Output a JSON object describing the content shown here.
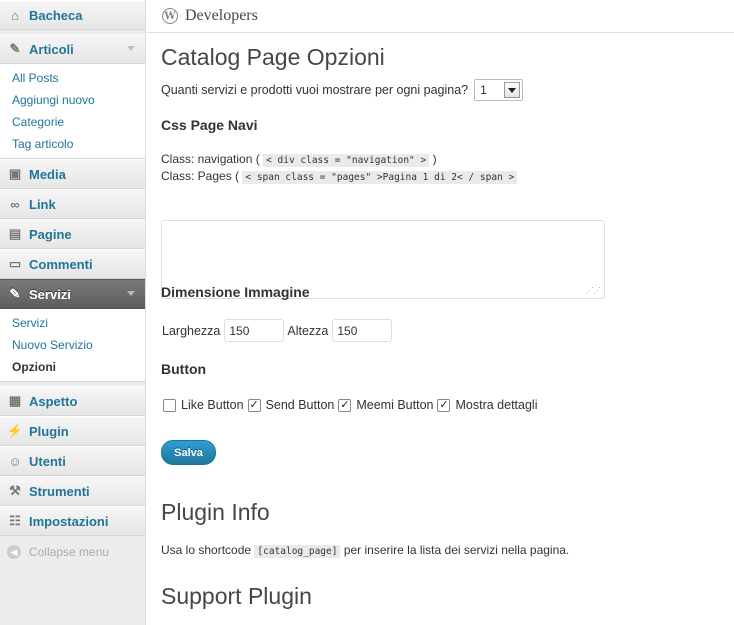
{
  "sidebar": {
    "bacheca": "Bacheca",
    "articoli": "Articoli",
    "articoli_items": [
      "All Posts",
      "Aggiungi nuovo",
      "Categorie",
      "Tag articolo"
    ],
    "media": "Media",
    "link": "Link",
    "pagine": "Pagine",
    "commenti": "Commenti",
    "servizi": "Servizi",
    "servizi_items": [
      "Servizi",
      "Nuovo Servizio",
      "Opzioni"
    ],
    "aspetto": "Aspetto",
    "plugin": "Plugin",
    "utenti": "Utenti",
    "strumenti": "Strumenti",
    "impostazioni": "Impostazioni",
    "collapse": "Collapse menu"
  },
  "header": {
    "site_name": "Developers"
  },
  "page": {
    "title": "Catalog Page Opzioni",
    "per_page_label": "Quanti servizi e prodotti vuoi mostrare per ogni pagina?",
    "per_page_value": "1",
    "css_title": "Css Page Navi",
    "class_nav_prefix": "Class: navigation (",
    "class_nav_code": "< div class = \"navigation\" >",
    "class_nav_suffix": ")",
    "class_pages_prefix": "Class: Pages (",
    "class_pages_code": "< span class = \"pages\" >Pagina 1 di 2< / span >",
    "css_textarea_value": "",
    "dim_title": "Dimensione Immagine",
    "larghezza_label": "Larghezza",
    "larghezza_value": "150",
    "altezza_label": "Altezza",
    "altezza_value": "150",
    "button_title": "Button",
    "buttons": [
      {
        "label": "Like Button",
        "checked": false
      },
      {
        "label": "Send Button",
        "checked": true
      },
      {
        "label": "Meemi Button",
        "checked": true
      },
      {
        "label": "Mostra dettagli",
        "checked": true
      }
    ],
    "save_label": "Salva",
    "plugin_info_title": "Plugin Info",
    "shortcode_prefix": "Usa lo shortcode",
    "shortcode_code": "[catalog_page]",
    "shortcode_suffix": "per inserire la lista dei servizi nella pagina.",
    "support_title": "Support Plugin"
  },
  "colors": {
    "link": "#21759b",
    "current_menu": "#6d6d6d",
    "primary_button": "#21759b"
  }
}
